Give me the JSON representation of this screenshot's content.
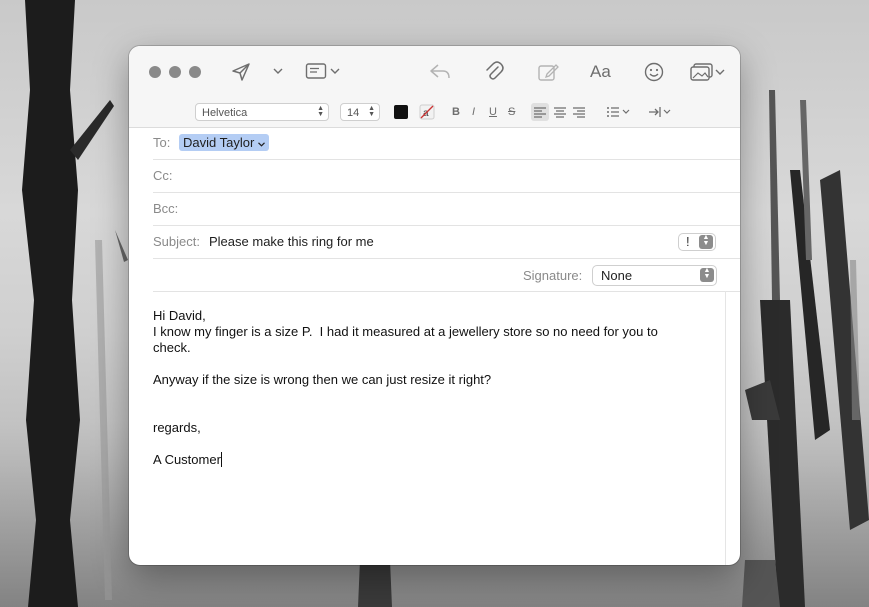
{
  "toolbar": {
    "send_icon": "send-icon",
    "header_fields_icon": "header-fields-icon",
    "reply_icon": "reply-icon",
    "attach_icon": "paperclip-icon",
    "markup_icon": "markup-icon",
    "format_label": "Aa",
    "emoji_icon": "emoji-icon",
    "photo_icon": "photo-browser-icon"
  },
  "format": {
    "font": "Helvetica",
    "size": "14",
    "text_color": "#111111",
    "bold": "B",
    "italic": "I",
    "underline": "U",
    "strike": "S"
  },
  "header": {
    "to_label": "To:",
    "to_recipient": "David Taylor",
    "cc_label": "Cc:",
    "bcc_label": "Bcc:",
    "subject_label": "Subject:",
    "subject_value": "Please make this ring for me",
    "priority": "!",
    "signature_label": "Signature:",
    "signature_value": "None"
  },
  "body": {
    "line1": "Hi David,",
    "line2": "I know my finger is a size P.  I had it measured at a jewellery store so no need for you to",
    "line3": "check.",
    "line4": "Anyway if the size is wrong then we can just resize it right?",
    "line5": "regards,",
    "line6": "A Customer"
  },
  "colors": {
    "token_bg": "#b4cdf4",
    "traffic_light": "#8a8a8a",
    "toolbar_bg": "#f6f6f6"
  }
}
